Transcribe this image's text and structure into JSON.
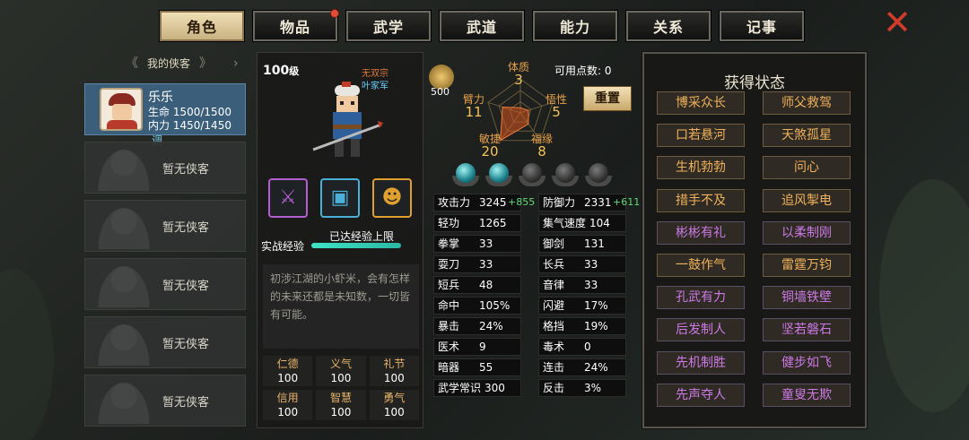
{
  "tabs": [
    {
      "label": "角色",
      "active": true,
      "badge": false
    },
    {
      "label": "物品",
      "active": false,
      "badge": true
    },
    {
      "label": "武学",
      "active": false,
      "badge": false
    },
    {
      "label": "武道",
      "active": false,
      "badge": false
    },
    {
      "label": "能力",
      "active": false,
      "badge": false
    },
    {
      "label": "关系",
      "active": false,
      "badge": false
    },
    {
      "label": "记事",
      "active": false,
      "badge": false
    }
  ],
  "close_icon": "close-icon",
  "sidebar": {
    "title": "我的侠客",
    "active_character": {
      "name": "乐乐",
      "hp_label": "生命",
      "hp": "1500/1500",
      "mp_label": "内力",
      "mp": "1450/1450",
      "adjust": "调"
    },
    "empty_label": "暂无侠客",
    "empty_slots": 5
  },
  "profile": {
    "level": "100",
    "level_suffix": "级",
    "sect": "无双宗",
    "clan": "叶家军",
    "exp_label": "实战经验",
    "exp_status": "已达经验上限",
    "exp_progress": 1.0,
    "bio": "初涉江湖的小虾米，会有怎样的未来还都是未知数，一切皆有可能。",
    "virtues": [
      {
        "name": "仁德",
        "value": "100"
      },
      {
        "name": "义气",
        "value": "100"
      },
      {
        "name": "礼节",
        "value": "100"
      },
      {
        "name": "信用",
        "value": "100"
      },
      {
        "name": "智慧",
        "value": "100"
      },
      {
        "name": "勇气",
        "value": "100"
      }
    ],
    "equipment": [
      {
        "icon": "sword-icon",
        "color": "#b25ed0"
      },
      {
        "icon": "armor-icon",
        "color": "#4ab0d8"
      },
      {
        "icon": "mask-icon",
        "color": "#e0a030"
      }
    ]
  },
  "attributes": {
    "points_value": "500",
    "free_points_label": "可用点数:",
    "free_points": "0",
    "reset_label": "重置",
    "radar": [
      {
        "name": "体质",
        "value": "3"
      },
      {
        "name": "悟性",
        "value": "5"
      },
      {
        "name": "福缘",
        "value": "8"
      },
      {
        "name": "敏捷",
        "value": "20"
      },
      {
        "name": "臂力",
        "value": "11"
      }
    ],
    "orbs": [
      true,
      true,
      false,
      false,
      false
    ]
  },
  "stats_left": [
    {
      "name": "攻击力",
      "value": "3245",
      "bonus": "+855"
    },
    {
      "name": "轻功",
      "value": "1265",
      "bonus": ""
    },
    {
      "name": "拳掌",
      "value": "33",
      "bonus": ""
    },
    {
      "name": "耍刀",
      "value": "33",
      "bonus": ""
    },
    {
      "name": "短兵",
      "value": "48",
      "bonus": ""
    },
    {
      "name": "命中",
      "value": "105%",
      "bonus": ""
    },
    {
      "name": "暴击",
      "value": "24%",
      "bonus": ""
    },
    {
      "name": "医术",
      "value": "9",
      "bonus": ""
    },
    {
      "name": "暗器",
      "value": "55",
      "bonus": ""
    },
    {
      "name": "武学常识",
      "value": "300",
      "bonus": ""
    }
  ],
  "stats_right": [
    {
      "name": "防御力",
      "value": "2331",
      "bonus": "+611"
    },
    {
      "name": "集气速度",
      "value": "104",
      "bonus": ""
    },
    {
      "name": "御剑",
      "value": "131",
      "bonus": ""
    },
    {
      "name": "长兵",
      "value": "33",
      "bonus": ""
    },
    {
      "name": "音律",
      "value": "33",
      "bonus": ""
    },
    {
      "name": "闪避",
      "value": "17%",
      "bonus": ""
    },
    {
      "name": "格挡",
      "value": "19%",
      "bonus": ""
    },
    {
      "name": "毒术",
      "value": "0",
      "bonus": ""
    },
    {
      "name": "连击",
      "value": "24%",
      "bonus": ""
    },
    {
      "name": "反击",
      "value": "3%",
      "bonus": ""
    }
  ],
  "status": {
    "title": "获得状态",
    "items": [
      {
        "label": "博采众长",
        "color": "orange"
      },
      {
        "label": "师父救驾",
        "color": "orange"
      },
      {
        "label": "口若悬河",
        "color": "orange"
      },
      {
        "label": "天煞孤星",
        "color": "orange"
      },
      {
        "label": "生机勃勃",
        "color": "orange"
      },
      {
        "label": "问心",
        "color": "orange"
      },
      {
        "label": "措手不及",
        "color": "orange"
      },
      {
        "label": "追风掣电",
        "color": "orange"
      },
      {
        "label": "彬彬有礼",
        "color": "purple"
      },
      {
        "label": "以柔制刚",
        "color": "purple"
      },
      {
        "label": "一鼓作气",
        "color": "orange"
      },
      {
        "label": "雷霆万钧",
        "color": "orange"
      },
      {
        "label": "孔武有力",
        "color": "purple"
      },
      {
        "label": "铜墙铁壁",
        "color": "purple"
      },
      {
        "label": "后发制人",
        "color": "purple"
      },
      {
        "label": "坚若磐石",
        "color": "purple"
      },
      {
        "label": "先机制胜",
        "color": "purple"
      },
      {
        "label": "健步如飞",
        "color": "purple"
      },
      {
        "label": "先声夺人",
        "color": "purple"
      },
      {
        "label": "童叟无欺",
        "color": "purple"
      }
    ]
  }
}
